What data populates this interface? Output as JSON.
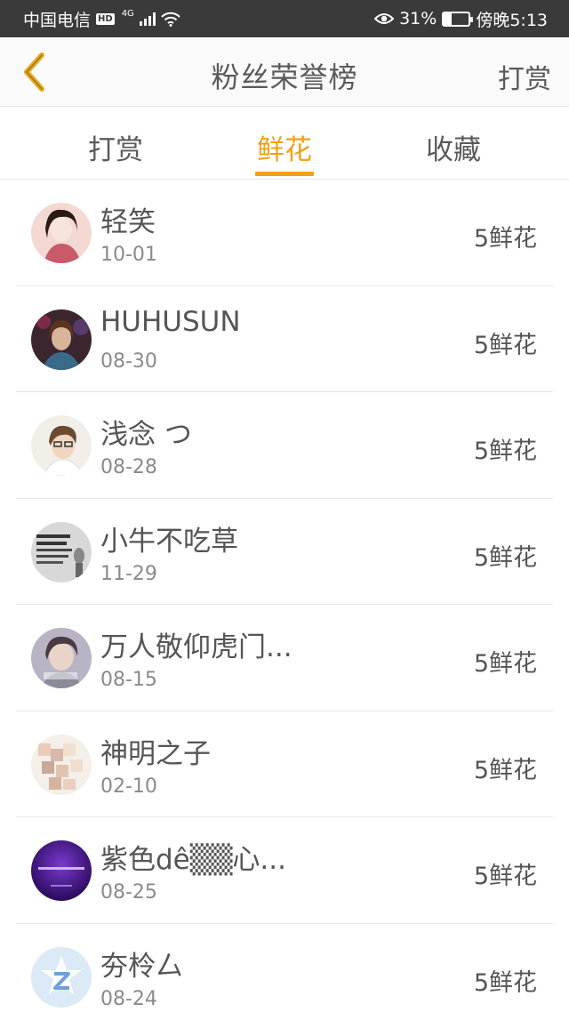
{
  "status_bar": {
    "carrier": "中国电信",
    "hd": "HD",
    "network": "4G",
    "battery_percent": "31%",
    "battery_level": 0.31,
    "time": "傍晚5:13"
  },
  "nav": {
    "title": "粉丝荣誉榜",
    "action": "打赏"
  },
  "tabs": [
    {
      "label": "打赏",
      "active": false
    },
    {
      "label": "鲜花",
      "active": true
    },
    {
      "label": "收藏",
      "active": false
    }
  ],
  "fans": [
    {
      "name": "轻笑",
      "date": "10-01",
      "gift": "5鲜花"
    },
    {
      "name": "HUHUSUN",
      "date": "08-30",
      "gift": "5鲜花"
    },
    {
      "name": "浅念 つ",
      "date": "08-28",
      "gift": "5鲜花"
    },
    {
      "name": "小牛不吃草",
      "date": "11-29",
      "gift": "5鲜花"
    },
    {
      "name": "万人敬仰虎门...",
      "date": "08-15",
      "gift": "5鲜花"
    },
    {
      "name": "神明之子",
      "date": "02-10",
      "gift": "5鲜花"
    },
    {
      "name": "紫色dê▒▒心...",
      "date": "08-25",
      "gift": "5鲜花"
    },
    {
      "name": "夯柃厶",
      "date": "08-24",
      "gift": "5鲜花"
    }
  ],
  "colors": {
    "accent": "#f2a016",
    "status_bar_bg": "#3a3a3a",
    "text": "#555555",
    "subtext": "#8a8a8a"
  }
}
